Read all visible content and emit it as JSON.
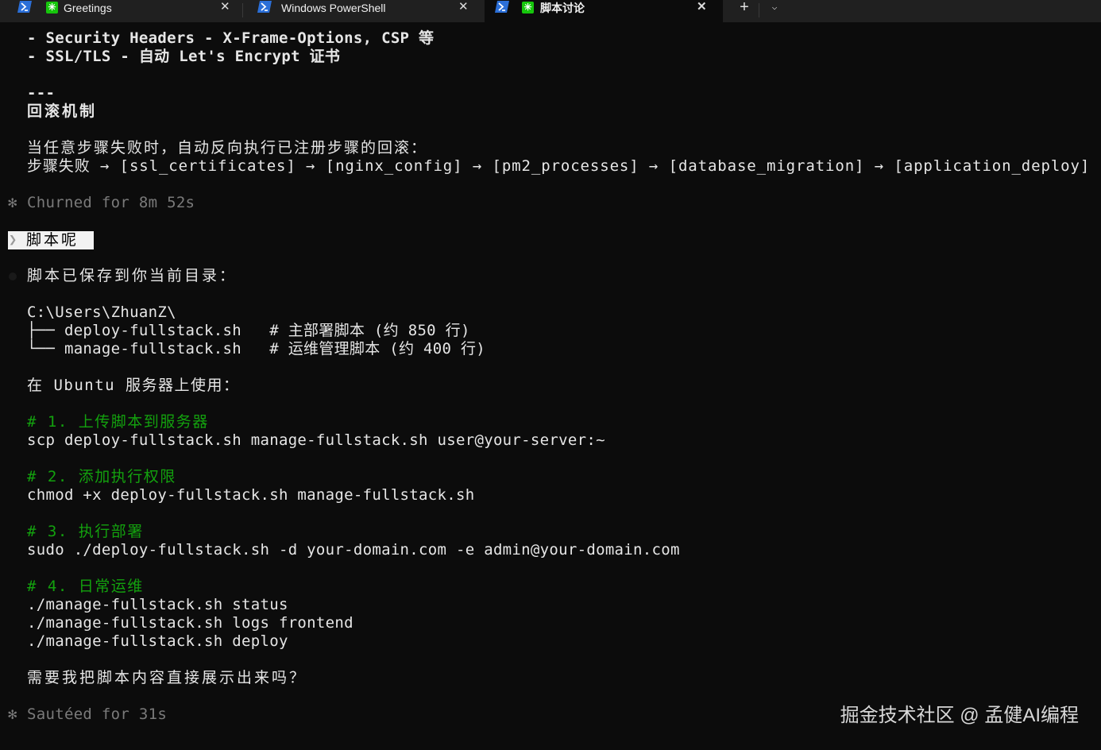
{
  "tabs": [
    {
      "title": "Greetings",
      "icon": "powershell-icon"
    },
    {
      "title": "Windows PowerShell",
      "icon": "powershell-icon"
    },
    {
      "title": "脚本讨论",
      "icon": "powershell-icon",
      "active": true
    }
  ],
  "tab_close_glyph": "✕",
  "tab_new_glyph": "+",
  "tab_dropdown_glyph": "⌵",
  "terminal": {
    "security_headers": "- Security Headers - X-Frame-Options, CSP 等",
    "ssl_tls": "- SSL/TLS - 自动 Let's Encrypt 证书",
    "separator": "---",
    "rollback_heading": "回滚机制",
    "rollback_desc": "当任意步骤失败时，自动反向执行已注册步骤的回滚：",
    "rollback_flow": "步骤失败 → [ssl_certificates] → [nginx_config] → [pm2_processes] → [database_migration] → [application_deploy]",
    "churned": "Churned for 8m 52s",
    "prompt_chevron": "❯",
    "user_prompt": "脚本呢",
    "saved_msg": "脚本已保存到你当前目录：",
    "dir_path": "C:\\Users\\ZhuanZ\\",
    "tree_item1": "├── deploy-fullstack.sh   # 主部署脚本 (约 850 行)",
    "tree_item2": "└── manage-fullstack.sh   # 运维管理脚本 (约 400 行)",
    "ubuntu_usage": "在 Ubuntu 服务器上使用：",
    "step1_comment": "# 1. 上传脚本到服务器",
    "step1_cmd": "scp deploy-fullstack.sh manage-fullstack.sh user@your-server:~",
    "step2_comment": "# 2. 添加执行权限",
    "step2_cmd": "chmod +x deploy-fullstack.sh manage-fullstack.sh",
    "step3_comment": "# 3. 执行部署",
    "step3_cmd": "sudo ./deploy-fullstack.sh -d your-domain.com -e admin@your-domain.com",
    "step4_comment": "# 4. 日常运维",
    "step4_cmd1": "./manage-fullstack.sh status",
    "step4_cmd2": "./manage-fullstack.sh logs frontend",
    "step4_cmd3": "./manage-fullstack.sh deploy",
    "question": "需要我把脚本内容直接展示出来吗？",
    "sauteed": "Sautéed for 31s",
    "spinner_glyph": "✻"
  },
  "watermark": "掘金技术社区 @ 孟健AI编程",
  "colors": {
    "background": "#0c0c0c",
    "foreground": "#e6e6e6",
    "comment_green": "#13a10e",
    "dim_gray": "#7a7a7a",
    "tabbar": "#202020",
    "powershell_blue": "#2b6fd8"
  }
}
